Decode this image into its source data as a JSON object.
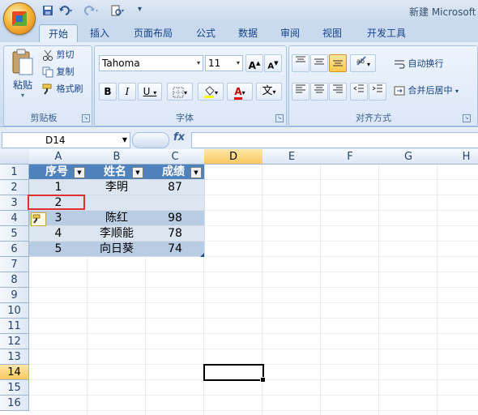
{
  "app_title": "新建 Microsoft",
  "tabs": [
    "开始",
    "插入",
    "页面布局",
    "公式",
    "数据",
    "审阅",
    "视图",
    "开发工具"
  ],
  "clipboard": {
    "paste": "粘贴",
    "cut": "剪切",
    "copy": "复制",
    "format_painter": "格式刷",
    "label": "剪贴板"
  },
  "font": {
    "name": "Tahoma",
    "size": "11",
    "label": "字体",
    "grow": "A",
    "shrink": "A",
    "bold": "B",
    "italic": "I",
    "underline": "U",
    "font_color_letter": "A",
    "phonetic": "文"
  },
  "alignment": {
    "wrap_text": "自动换行",
    "merge_center": "合并后居中",
    "label": "对齐方式"
  },
  "formula_bar": {
    "name_box": "D14",
    "fx": "fx",
    "content": ""
  },
  "columns": [
    "A",
    "B",
    "C",
    "D",
    "E",
    "F",
    "G",
    "H"
  ],
  "rows": [
    "1",
    "2",
    "3",
    "4",
    "5",
    "6",
    "7",
    "8",
    "9",
    "10",
    "11",
    "12",
    "13",
    "14",
    "15",
    "16"
  ],
  "selected_cell": "D14",
  "table": {
    "headers": [
      "序号",
      "姓名",
      "成绩"
    ],
    "rows": [
      [
        "1",
        "李明",
        "87"
      ],
      [
        "2",
        "",
        ""
      ],
      [
        "3",
        "陈红",
        "98"
      ],
      [
        "4",
        "李顺能",
        "78"
      ],
      [
        "5",
        "向日葵",
        "74"
      ]
    ]
  },
  "colors": {
    "header_fill": "#4f81bd",
    "band_dark": "#b8cce4",
    "band_light": "#dce6f1",
    "highlight_box": "#e03030",
    "selection_fill": "#f8c862"
  }
}
